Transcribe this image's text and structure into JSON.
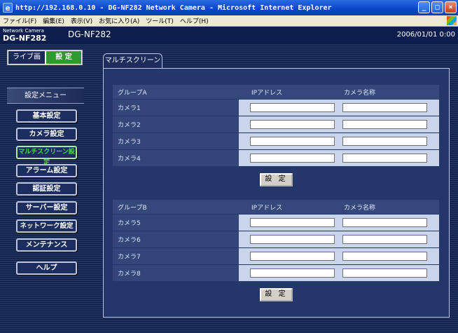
{
  "window": {
    "title": "http://192.168.0.10 - DG-NF282 Network Camera - Microsoft Internet Explorer",
    "ie_icon": "ie-icon",
    "controls": [
      "_",
      "□",
      "×"
    ]
  },
  "menubar": {
    "items": [
      "ファイル(F)",
      "編集(E)",
      "表示(V)",
      "お気に入り(A)",
      "ツール(T)",
      "ヘルプ(H)"
    ]
  },
  "header": {
    "brand_small": "Network Camera",
    "brand_model": "DG-NF282",
    "model": "DG-NF282",
    "datetime": "2006/01/01 0:00"
  },
  "mode_tabs": {
    "live": "ライブ画",
    "settings": "設 定"
  },
  "sidebar": {
    "title": "設定メニュー",
    "items": [
      {
        "label": "基本設定",
        "active": false
      },
      {
        "label": "カメラ設定",
        "active": false
      },
      {
        "label": "マルチスクリーン設定",
        "active": true
      },
      {
        "label": "アラーム設定",
        "active": false
      },
      {
        "label": "認証設定",
        "active": false
      },
      {
        "label": "サーバー設定",
        "active": false
      },
      {
        "label": "ネットワーク設定",
        "active": false
      },
      {
        "label": "メンテナンス",
        "active": false
      },
      {
        "label": "ヘルプ",
        "active": false
      }
    ]
  },
  "main": {
    "tab": "マルチスクリーン",
    "groups": [
      {
        "header": "グループA",
        "col_ip": "IPアドレス",
        "col_name": "カメラ名称",
        "cameras": [
          {
            "label": "カメラ1",
            "ip": "",
            "name": ""
          },
          {
            "label": "カメラ2",
            "ip": "",
            "name": ""
          },
          {
            "label": "カメラ3",
            "ip": "",
            "name": ""
          },
          {
            "label": "カメラ4",
            "ip": "",
            "name": ""
          }
        ],
        "submit": "設 定"
      },
      {
        "header": "グループB",
        "col_ip": "IPアドレス",
        "col_name": "カメラ名称",
        "cameras": [
          {
            "label": "カメラ5",
            "ip": "",
            "name": ""
          },
          {
            "label": "カメラ6",
            "ip": "",
            "name": ""
          },
          {
            "label": "カメラ7",
            "ip": "",
            "name": ""
          },
          {
            "label": "カメラ8",
            "ip": "",
            "name": ""
          }
        ],
        "submit": "設 定"
      }
    ]
  }
}
